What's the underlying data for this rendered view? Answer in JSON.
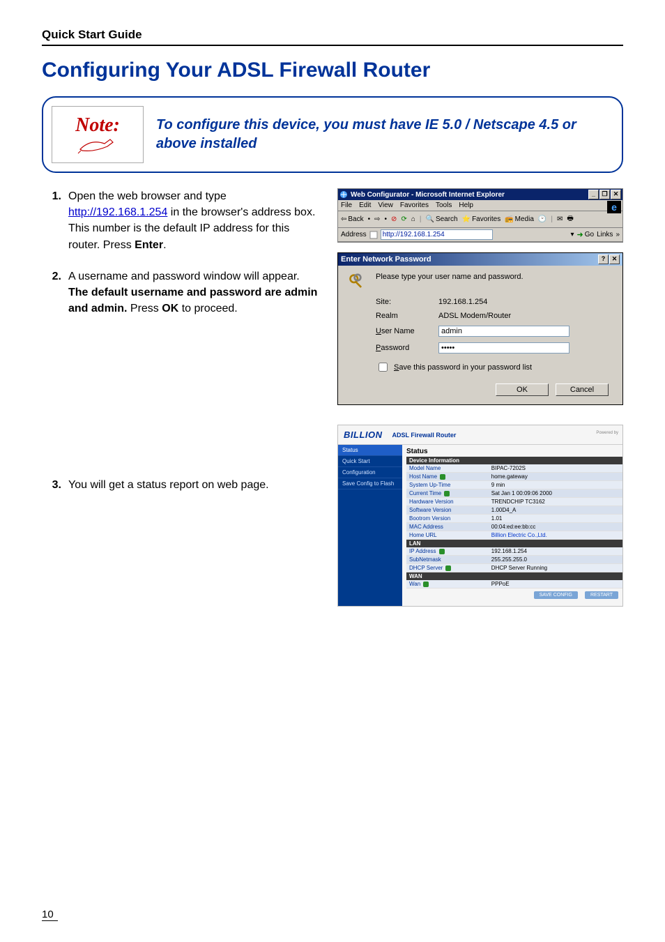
{
  "header": {
    "doc_title": "Quick Start Guide"
  },
  "heading": "Configuring Your ADSL Firewall Router",
  "note": {
    "icon_label": "Note:",
    "text": "To configure this device, you must have IE 5.0 / Netscape 4.5 or above installed"
  },
  "steps": [
    {
      "num": "1.",
      "pre": "Open the web browser and type ",
      "link": "http://192.168.1.254",
      "mid": " in the browser's address box. This number is the default IP address for this router.    Press ",
      "bold": "Enter",
      "post": "."
    },
    {
      "num": "2.",
      "pre": "A username and password window will appear. ",
      "bold": "The default username and password are admin and admin.",
      "mid": "    Press ",
      "bold2": "OK",
      "post": " to proceed."
    },
    {
      "num": "3.",
      "pre": "You will get a status report on web page."
    }
  ],
  "ie": {
    "title": "Web Configurator - Microsoft Internet Explorer",
    "menus": [
      "File",
      "Edit",
      "View",
      "Favorites",
      "Tools",
      "Help"
    ],
    "back": "Back",
    "search": "Search",
    "favorites": "Favorites",
    "media": "Media",
    "address_label": "Address",
    "address_value": "http://192.168.1.254",
    "go": "Go",
    "links": "Links"
  },
  "pw": {
    "title": "Enter Network Password",
    "prompt": "Please type your user name and password.",
    "site_label": "Site:",
    "site_value": "192.168.1.254",
    "realm_label": "Realm",
    "realm_value": "ADSL Modem/Router",
    "user_label": "User Name",
    "user_value": "admin",
    "user_underline": "U",
    "pass_label": "Password",
    "pass_value": "•••••",
    "pass_underline": "P",
    "save_label": "Save this password in your password list",
    "save_underline": "S",
    "ok": "OK",
    "cancel": "Cancel"
  },
  "status": {
    "brand": "BILLION",
    "subtitle": "ADSL Firewall Router",
    "powered": "Powered by",
    "nav": [
      "Status",
      "Quick Start",
      "Configuration",
      "Save Config to Flash"
    ],
    "heading": "Status",
    "sections": {
      "device": {
        "title": "Device Information",
        "rows": [
          [
            "Model Name",
            "BIPAC-7202S"
          ],
          [
            "Host Name",
            "home.gateway"
          ],
          [
            "System Up-Time",
            "9 min"
          ],
          [
            "Current Time",
            "Sat Jan 1 00:09:06 2000"
          ],
          [
            "Hardware Version",
            "TRENDCHIP TC3162"
          ],
          [
            "Software Version",
            "1.00D4_A"
          ],
          [
            "Bootrom Version",
            "1.01"
          ],
          [
            "MAC Address",
            "00:04:ed:ee:bb:cc"
          ],
          [
            "Home URL",
            "Billion Electric Co.,Ltd."
          ]
        ]
      },
      "lan": {
        "title": "LAN",
        "rows": [
          [
            "IP Address",
            "192.168.1.254"
          ],
          [
            "SubNetmask",
            "255.255.255.0"
          ],
          [
            "DHCP Server",
            "DHCP Server Running"
          ]
        ]
      },
      "wan": {
        "title": "WAN",
        "rows": [
          [
            "Wan",
            "PPPoE"
          ]
        ]
      }
    },
    "buttons": {
      "save": "SAVE CONFIG",
      "restart": "RESTART"
    }
  },
  "page_number": "10"
}
